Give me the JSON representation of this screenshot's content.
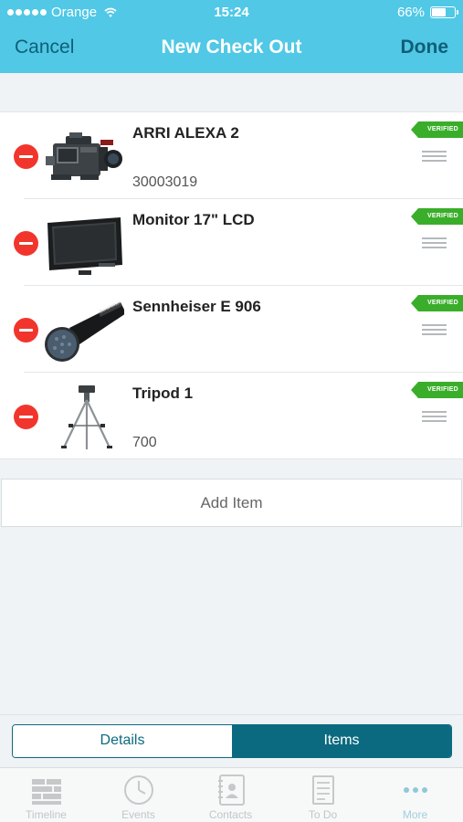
{
  "status_bar": {
    "carrier": "Orange",
    "time": "15:24",
    "battery": "66%",
    "battery_level": 0.66
  },
  "nav": {
    "cancel": "Cancel",
    "title": "New Check Out",
    "done": "Done"
  },
  "items": [
    {
      "name": "ARRI ALEXA 2",
      "code": "30003019",
      "badge": "VERIFIED",
      "thumb_icon": "camera-icon"
    },
    {
      "name": "Monitor 17\" LCD",
      "code": "",
      "badge": "VERIFIED",
      "thumb_icon": "monitor-icon"
    },
    {
      "name": "Sennheiser E 906",
      "code": "",
      "badge": "VERIFIED",
      "thumb_icon": "microphone-icon"
    },
    {
      "name": "Tripod 1",
      "code": "700",
      "badge": "VERIFIED",
      "thumb_icon": "tripod-icon"
    }
  ],
  "add_item": "Add Item",
  "segments": {
    "details": "Details",
    "items": "Items",
    "selected": "Items"
  },
  "tabs": [
    {
      "label": "Timeline",
      "icon": "timeline-icon"
    },
    {
      "label": "Events",
      "icon": "clock-icon"
    },
    {
      "label": "Contacts",
      "icon": "address-book-icon"
    },
    {
      "label": "To Do",
      "icon": "checklist-icon"
    },
    {
      "label": "More",
      "icon": "more-dots-icon"
    }
  ],
  "colors": {
    "header": "#50c8e6",
    "nav_button": "#0f5f77",
    "segment_accent": "#0b6a80",
    "verified": "#3aae2a",
    "remove": "#f2352c"
  }
}
